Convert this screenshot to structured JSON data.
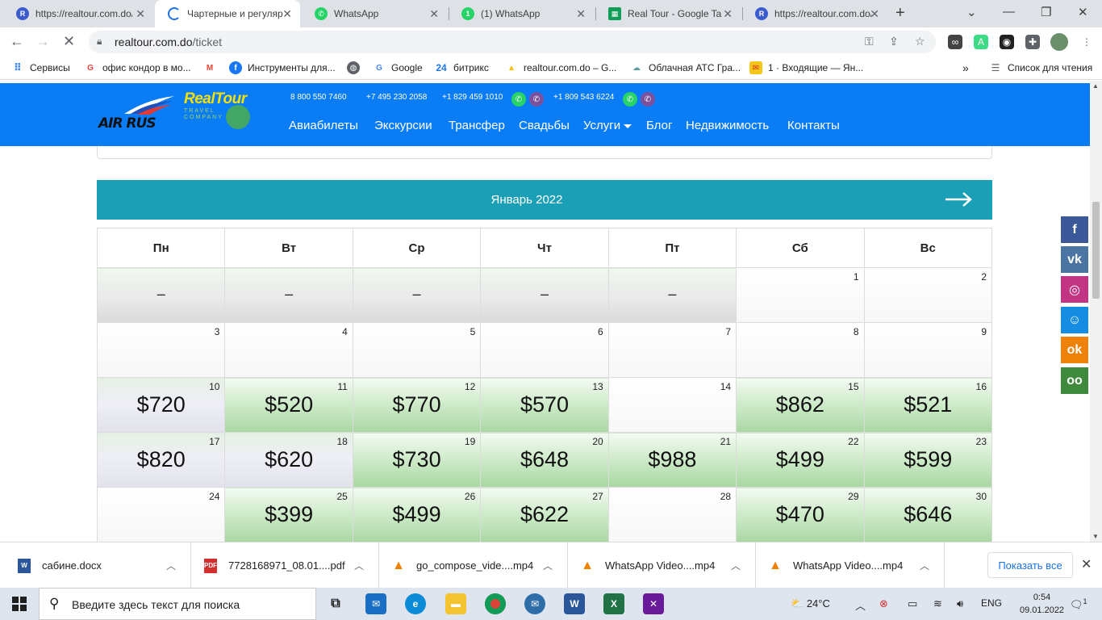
{
  "browser": {
    "tabs": [
      {
        "title": "https://realtour.com.do/",
        "icon": "realtour-favicon",
        "active": false
      },
      {
        "title": "Чартерные и регуляр",
        "icon": "loading-icon",
        "active": true
      },
      {
        "title": "WhatsApp",
        "icon": "whatsapp-icon",
        "active": false
      },
      {
        "title": "(1) WhatsApp",
        "icon": "whatsapp-icon",
        "active": false
      },
      {
        "title": "Real Tour - Google Ta",
        "icon": "google-sheets-icon",
        "active": false
      },
      {
        "title": "https://realtour.com.do/",
        "icon": "realtour-favicon",
        "active": false
      }
    ],
    "url_host": "realtour.com.do",
    "url_path": "/ticket",
    "bookmarks": [
      {
        "label": "Сервисы",
        "icon": "apps-icon"
      },
      {
        "label": "офис кондор в мо...",
        "icon": "google-icon"
      },
      {
        "label": "",
        "icon": "gmail-icon"
      },
      {
        "label": "Инструменты для...",
        "icon": "facebook-icon"
      },
      {
        "label": "",
        "icon": "globe-icon"
      },
      {
        "label": "Google",
        "icon": "google-icon"
      },
      {
        "label": "битрикс",
        "icon": "bitrix24-icon"
      },
      {
        "label": "realtour.com.do – G...",
        "icon": "google-drive-icon"
      },
      {
        "label": "Облачная АТС Гра...",
        "icon": "cloud-pbx-icon"
      },
      {
        "label": "1 · Входящие — Ян...",
        "icon": "yandex-mail-icon"
      }
    ],
    "reading_list": "Список для чтения"
  },
  "site": {
    "logo_left": "AIR RUS",
    "logo_right": "RealTour",
    "logo_right_sub": "TRAVEL COMPANY",
    "phones": [
      "8 800 550 7460",
      "+7 495 230 2058",
      "+1 829 459 1010",
      "+1 809 543 6224"
    ],
    "nav": [
      "Авиабилеты",
      "Экскурсии",
      "Трансфер",
      "Свадьбы",
      "Услуги",
      "Блог",
      "Недвижимость",
      "Контакты"
    ]
  },
  "calendar": {
    "month": "Январь 2022",
    "weekdays": [
      "Пн",
      "Вт",
      "Ср",
      "Чт",
      "Пт",
      "Сб",
      "Вс"
    ],
    "weeks": [
      [
        {
          "d": "",
          "p": "–",
          "t": "none"
        },
        {
          "d": "",
          "p": "–",
          "t": "none"
        },
        {
          "d": "",
          "p": "–",
          "t": "none"
        },
        {
          "d": "",
          "p": "–",
          "t": "none"
        },
        {
          "d": "",
          "p": "–",
          "t": "none"
        },
        {
          "d": "1",
          "p": "",
          "t": "empty"
        },
        {
          "d": "2",
          "p": "",
          "t": "empty"
        }
      ],
      [
        {
          "d": "3",
          "p": "",
          "t": "empty"
        },
        {
          "d": "4",
          "p": "",
          "t": "empty"
        },
        {
          "d": "5",
          "p": "",
          "t": "empty"
        },
        {
          "d": "6",
          "p": "",
          "t": "empty"
        },
        {
          "d": "7",
          "p": "",
          "t": "empty"
        },
        {
          "d": "8",
          "p": "",
          "t": "empty"
        },
        {
          "d": "9",
          "p": "",
          "t": "empty"
        }
      ],
      [
        {
          "d": "10",
          "p": "$720",
          "t": "grey"
        },
        {
          "d": "11",
          "p": "$520",
          "t": "green"
        },
        {
          "d": "12",
          "p": "$770",
          "t": "green"
        },
        {
          "d": "13",
          "p": "$570",
          "t": "green"
        },
        {
          "d": "14",
          "p": "",
          "t": "empty"
        },
        {
          "d": "15",
          "p": "$862",
          "t": "green"
        },
        {
          "d": "16",
          "p": "$521",
          "t": "green"
        }
      ],
      [
        {
          "d": "17",
          "p": "$820",
          "t": "grey"
        },
        {
          "d": "18",
          "p": "$620",
          "t": "grey"
        },
        {
          "d": "19",
          "p": "$730",
          "t": "green"
        },
        {
          "d": "20",
          "p": "$648",
          "t": "green"
        },
        {
          "d": "21",
          "p": "$988",
          "t": "green"
        },
        {
          "d": "22",
          "p": "$499",
          "t": "green"
        },
        {
          "d": "23",
          "p": "$599",
          "t": "green"
        }
      ],
      [
        {
          "d": "24",
          "p": "",
          "t": "empty"
        },
        {
          "d": "25",
          "p": "$399",
          "t": "green"
        },
        {
          "d": "26",
          "p": "$499",
          "t": "green"
        },
        {
          "d": "27",
          "p": "$622",
          "t": "green"
        },
        {
          "d": "28",
          "p": "",
          "t": "empty"
        },
        {
          "d": "29",
          "p": "$470",
          "t": "green"
        },
        {
          "d": "30",
          "p": "$646",
          "t": "green"
        }
      ]
    ]
  },
  "social": [
    {
      "name": "facebook-icon",
      "glyph": "f",
      "color": "#3b5998"
    },
    {
      "name": "vk-icon",
      "glyph": "vk",
      "color": "#4c75a3"
    },
    {
      "name": "instagram-icon",
      "glyph": "◎",
      "color": "#c13584"
    },
    {
      "name": "moimir-icon",
      "glyph": "☺",
      "color": "#168de2"
    },
    {
      "name": "odnoklassniki-icon",
      "glyph": "ok",
      "color": "#ee8208"
    },
    {
      "name": "tripadvisor-icon",
      "glyph": "oo",
      "color": "#3f8a3c"
    }
  ],
  "downloads": [
    {
      "name": "сабине.docx",
      "icon": "word-file-icon"
    },
    {
      "name": "7728168971_08.01....pdf",
      "icon": "pdf-file-icon"
    },
    {
      "name": "go_compose_vide....mp4",
      "icon": "vlc-file-icon"
    },
    {
      "name": "WhatsApp Video....mp4",
      "icon": "vlc-file-icon"
    },
    {
      "name": "WhatsApp Video....mp4",
      "icon": "vlc-file-icon"
    }
  ],
  "show_all": "Показать все",
  "taskbar": {
    "search_placeholder": "Введите здесь текст для поиска",
    "weather": "24°C",
    "lang": "ENG",
    "time": "0:54",
    "date": "09.01.2022",
    "notifications": "1"
  },
  "colors": {
    "header_blue": "#0a7cf6",
    "month_bar": "#1a9fb6",
    "price_green": "#a9d7a2"
  }
}
